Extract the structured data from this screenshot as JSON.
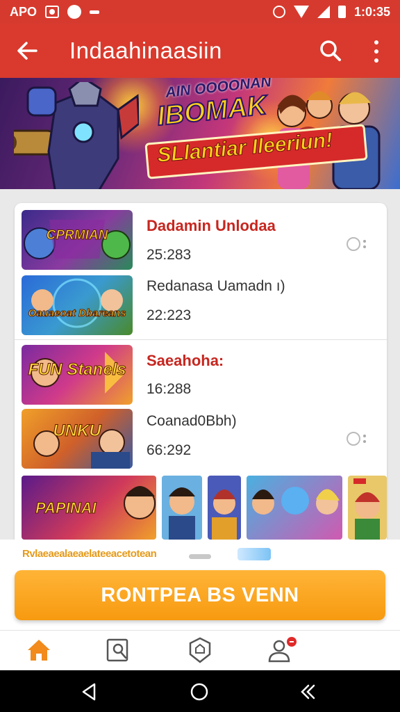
{
  "statusbar": {
    "carrier": "APO",
    "time": "1:0:35",
    "icons": [
      "notification-box-icon",
      "notification-circle-icon",
      "notification-dash-icon",
      "alarm-icon",
      "wifi-icon",
      "signal-icon",
      "battery-icon"
    ]
  },
  "appbar": {
    "title": "Indaahinaasiin",
    "back_icon": "arrow-left-icon",
    "search_icon": "search-icon",
    "more_icon": "more-vertical-icon",
    "color": "#d93a2d"
  },
  "banner": {
    "line1": "AIN OOOONAN",
    "line2": "IBOMAK",
    "line3": "SLlantiar Ileeriun!"
  },
  "list": {
    "groups": [
      {
        "title": "Dadamin Unlodaa",
        "items": [
          {
            "thumb_label": "CPRMIAN",
            "value": "25:283"
          },
          {
            "thumb_label": "Oauaeoat Dbareans",
            "text": "Redanasa Uamadn ı)",
            "value": "22:223"
          }
        ]
      },
      {
        "title": "Saeahoha:",
        "items": [
          {
            "thumb_label": "FUN Stanels",
            "value": "16:288"
          },
          {
            "thumb_label": "UNKU",
            "text": "Coanad0Bbh)",
            "value": "66:292"
          }
        ]
      }
    ],
    "strip_label": "PAPINAI"
  },
  "sheet": {
    "promo_text": "Rvlaeaealaeaelateeacetotean",
    "cta_label": "RONTPEA BS VENN"
  },
  "bottom_nav": {
    "items": [
      {
        "name": "home",
        "icon": "home-icon",
        "active": true
      },
      {
        "name": "library",
        "icon": "bookmark-search-icon"
      },
      {
        "name": "badge",
        "icon": "shield-badge-icon"
      },
      {
        "name": "profile",
        "icon": "user-icon",
        "badge": "notification-dot"
      }
    ],
    "accent": "#f28a1c"
  },
  "system_nav": {
    "icons": [
      "back-triangle-icon",
      "home-circle-icon",
      "recents-chevron-icon"
    ]
  }
}
